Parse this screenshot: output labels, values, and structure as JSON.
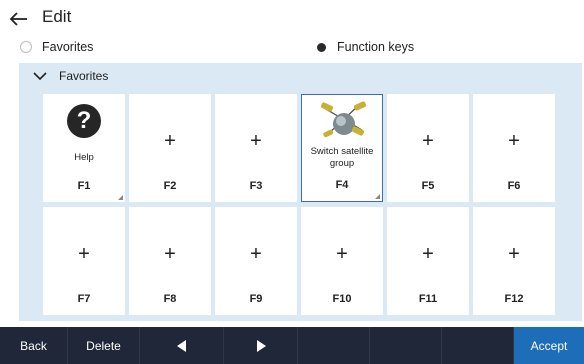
{
  "header": {
    "title": "Edit",
    "back_icon": "arrow-left-icon"
  },
  "mode": {
    "options": [
      {
        "label": "Favorites",
        "selected": false
      },
      {
        "label": "Function keys",
        "selected": true
      }
    ]
  },
  "panel": {
    "title": "Favorites",
    "collapse_icon": "chevron-down-icon",
    "background": "#dbe9f4"
  },
  "tiles": [
    {
      "key": "F1",
      "caption": "Help",
      "icon": "help-icon",
      "selected": false
    },
    {
      "key": "F2",
      "symbol": "+"
    },
    {
      "key": "F3",
      "symbol": "+"
    },
    {
      "key": "F4",
      "caption_line1": "Switch satellite",
      "caption_line2": "group",
      "icon": "satellite-icon",
      "selected": true
    },
    {
      "key": "F5",
      "symbol": "+"
    },
    {
      "key": "F6",
      "symbol": "+"
    },
    {
      "key": "F7",
      "symbol": "+"
    },
    {
      "key": "F8",
      "symbol": "+"
    },
    {
      "key": "F9",
      "symbol": "+"
    },
    {
      "key": "F10",
      "symbol": "+"
    },
    {
      "key": "F11",
      "symbol": "+"
    },
    {
      "key": "F12",
      "symbol": "+"
    }
  ],
  "help_glyph": "?",
  "toolbar": {
    "back": "Back",
    "delete": "Delete",
    "prev_icon": "triangle-left-icon",
    "next_icon": "triangle-right-icon",
    "accept": "Accept",
    "colors": {
      "bar": "#202738",
      "accept": "#1e6db8"
    }
  }
}
